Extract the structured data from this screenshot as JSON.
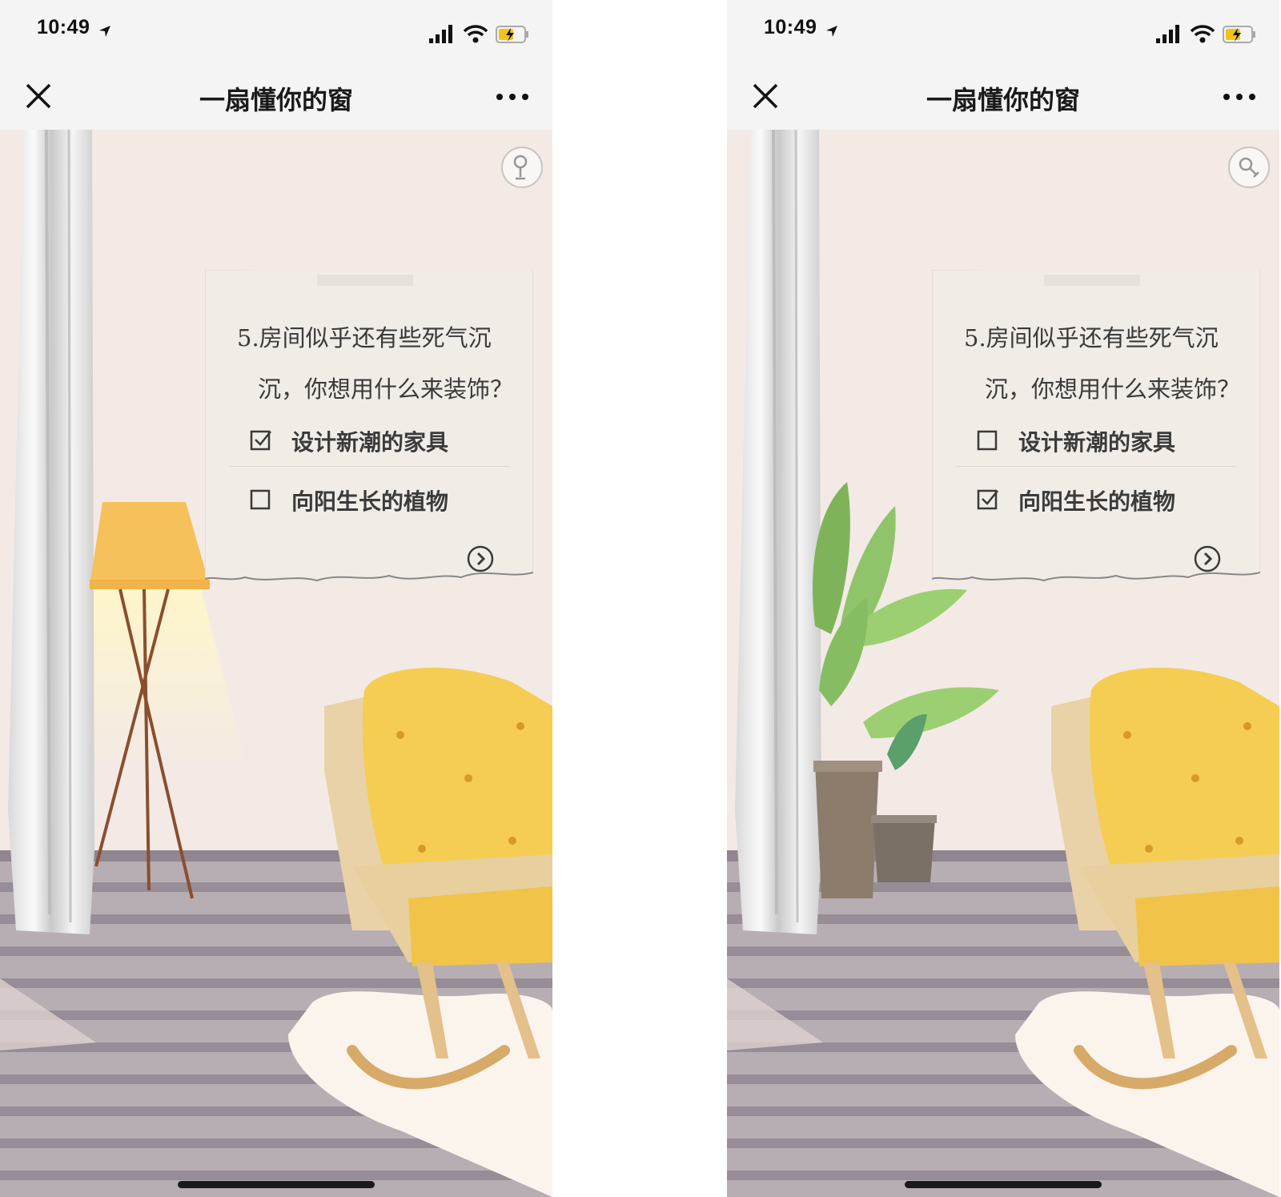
{
  "screens": [
    {
      "status_bar": {
        "time": "10:49"
      },
      "nav": {
        "title": "一扇懂你的窗"
      },
      "question": {
        "line1": "5.房间似乎还有些死气沉",
        "line2": "沉，你想用什么来装饰？"
      },
      "options": [
        {
          "label": "设计新潮的家具",
          "checked": true
        },
        {
          "label": "向阳生长的植物",
          "checked": false
        }
      ]
    },
    {
      "status_bar": {
        "time": "10:49"
      },
      "nav": {
        "title": "一扇懂你的窗"
      },
      "question": {
        "line1": "5.房间似乎还有些死气沉",
        "line2": "沉，你想用什么来装饰？"
      },
      "options": [
        {
          "label": "设计新潮的家具",
          "checked": false
        },
        {
          "label": "向阳生长的植物",
          "checked": true
        }
      ]
    }
  ],
  "icons": {
    "location_arrow": "location-arrow-icon",
    "signal": "signal-icon",
    "wifi": "wifi-icon",
    "battery": "battery-charging-icon",
    "close": "close-icon",
    "more": "more-icon",
    "profile": "profile-icon",
    "next": "chevron-right-circle-icon",
    "checkbox_checked": "checkbox-checked-icon",
    "checkbox_empty": "checkbox-empty-icon"
  },
  "colors": {
    "wall": "#f3eae6",
    "floor_stripe_dark": "#938a93",
    "floor_stripe_light": "#b3aab0",
    "chair_yellow": "#f5cd52",
    "lamp_shade": "#f7c15a",
    "plant_green": "#8fc46a",
    "text_dark": "#3a3a3a"
  }
}
